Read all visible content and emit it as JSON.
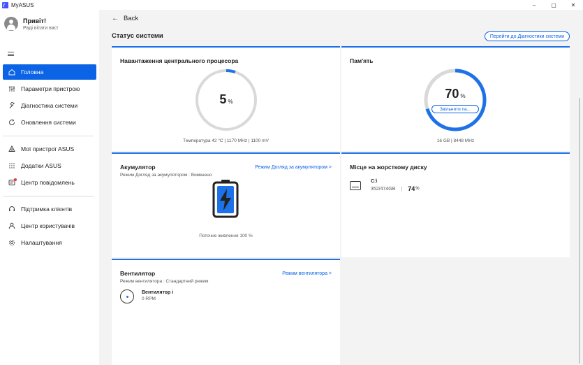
{
  "titlebar": {
    "app_name": "MyASUS",
    "minimize": "–",
    "maximize": "▢",
    "close": "✕"
  },
  "profile": {
    "greeting": "Привіт!",
    "subtitle": "Раді вітати вас!"
  },
  "sidebar": {
    "items": [
      {
        "label": "Головна",
        "icon": "home-icon",
        "active": true
      },
      {
        "label": "Параметри пристрою",
        "icon": "sliders-icon"
      },
      {
        "label": "Діагностика системи",
        "icon": "wrench-icon"
      },
      {
        "label": "Оновлення системи",
        "icon": "refresh-icon"
      },
      {
        "label": "Мої пристрої ASUS",
        "icon": "devices-icon"
      },
      {
        "label": "Додатки ASUS",
        "icon": "apps-grid-icon"
      },
      {
        "label": "Центр повідомлень",
        "icon": "notification-icon"
      },
      {
        "label": "Підтримка клієнтів",
        "icon": "support-icon"
      },
      {
        "label": "Центр користувачів",
        "icon": "user-icon"
      },
      {
        "label": "Налаштування",
        "icon": "gear-icon"
      }
    ]
  },
  "header": {
    "back_label": "Back",
    "section_title": "Статус системи",
    "diagnostics_button": "Перейти до Діагностики системи"
  },
  "cpu": {
    "title": "Навантаження центрального процесора",
    "value": "5",
    "value_fraction": 0.05,
    "unit": "%",
    "stats": "Температура 42 °C  |  1170 MHz  |  1100 mV"
  },
  "memory": {
    "title": "Пам'ять",
    "value": "70",
    "value_fraction": 0.7,
    "unit": "%",
    "free_button": "Звільнити па...",
    "stats": "16 GB  |  8448 MHz"
  },
  "battery": {
    "title": "Акумулятор",
    "mode_line": "Режим Догляд за акумулятором   : Вимкнено",
    "link": "Режим Догляд за акумулятором  >",
    "power_line": "Поточне живлення 100 %",
    "charge_fraction": 1.0
  },
  "disk": {
    "title": "Місце на жорсткому диску",
    "drive": "C:\\",
    "size": "352/474GB",
    "separator": "|",
    "value": "74",
    "unit": "%"
  },
  "fan": {
    "title": "Вентилятор",
    "mode_line": "Режим вентилятора : Стандартний режим",
    "link": "Режим вентилятора >",
    "name": "Вентилятор і",
    "rpm": "0 RPM"
  },
  "colors": {
    "accent": "#1e72e8",
    "active_nav": "#0b63e5",
    "gauge_track": "#d9d9d9"
  }
}
